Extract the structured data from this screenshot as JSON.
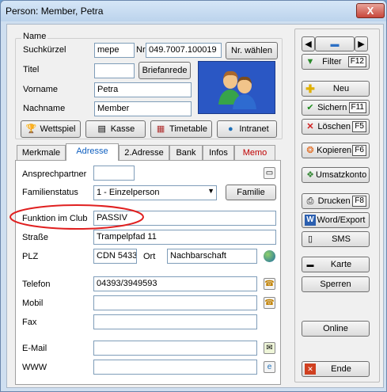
{
  "window": {
    "title": "Person: Member, Petra",
    "close": "X"
  },
  "name_group": {
    "title": "Name",
    "suchkuerzel_label": "Suchkürzel",
    "suchkuerzel_value": "mepe",
    "nr_label": "Nr",
    "nr_value": "049.7007.100019",
    "nr_waehlen": "Nr. wählen",
    "titel_label": "Titel",
    "titel_value": "",
    "briefanrede": "Briefanrede",
    "vorname_label": "Vorname",
    "vorname_value": "Petra",
    "nachname_label": "Nachname",
    "nachname_value": "Member"
  },
  "action_buttons": {
    "wettspiel": "Wettspiel",
    "kasse": "Kasse",
    "timetable": "Timetable",
    "intranet": "Intranet"
  },
  "tabs": [
    "Merkmale",
    "Adresse",
    "2.Adresse",
    "Bank",
    "Infos",
    "Memo"
  ],
  "address": {
    "ansprechpartner_label": "Ansprechpartner",
    "ansprechpartner_value": "",
    "familienstatus_label": "Familienstatus",
    "familienstatus_value": "1 - Einzelperson",
    "familie_button": "Familie",
    "funktion_label": "Funktion im Club",
    "funktion_value": "PASSIV",
    "strasse_label": "Straße",
    "strasse_value": "Trampelpfad 11",
    "plz_label": "PLZ",
    "plz_value": "CDN 5433",
    "ort_label": "Ort",
    "ort_value": "Nachbarschaft",
    "telefon_label": "Telefon",
    "telefon_value": "04393/3949593",
    "mobil_label": "Mobil",
    "mobil_value": "",
    "fax_label": "Fax",
    "fax_value": "",
    "email_label": "E-Mail",
    "email_value": "",
    "www_label": "WWW",
    "www_value": ""
  },
  "sidebar": {
    "filter": "Filter",
    "filter_key": "F12",
    "neu": "Neu",
    "sichern": "Sichern",
    "sichern_key": "F11",
    "loeschen": "Löschen",
    "loeschen_key": "F5",
    "kopieren": "Kopieren",
    "kopieren_key": "F6",
    "umsatzkonto": "Umsatzkonto",
    "drucken": "Drucken",
    "drucken_key": "F8",
    "word_export": "Word/Export",
    "sms": "SMS",
    "karte": "Karte",
    "sperren": "Sperren",
    "online": "Online",
    "ende": "Ende"
  },
  "colors": {
    "accent": "#1060c0",
    "highlight_ellipse": "#e02020",
    "memo_tab": "#c00000",
    "photo_bg": "#2a57c4"
  }
}
